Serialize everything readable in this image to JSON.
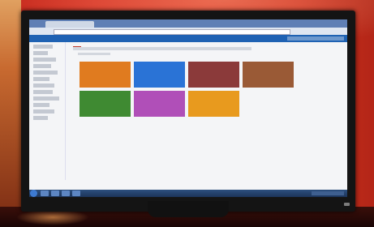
{
  "monitor": {
    "brand": "LG"
  },
  "tiles": [
    {
      "color": "#e07b1f",
      "label": ""
    },
    {
      "color": "#2a73d6",
      "label": ""
    },
    {
      "color": "#8b3a3a",
      "label": ""
    },
    {
      "color": "#9a5a36",
      "label": ""
    },
    {
      "color": "#3f8a32",
      "label": ""
    },
    {
      "color": "#b04fb8",
      "label": ""
    },
    {
      "color": "#e89a1e",
      "label": ""
    }
  ],
  "colors": {
    "wall": "#d83224",
    "app_header": "#1f62b3",
    "taskbar": "#1c345a"
  }
}
